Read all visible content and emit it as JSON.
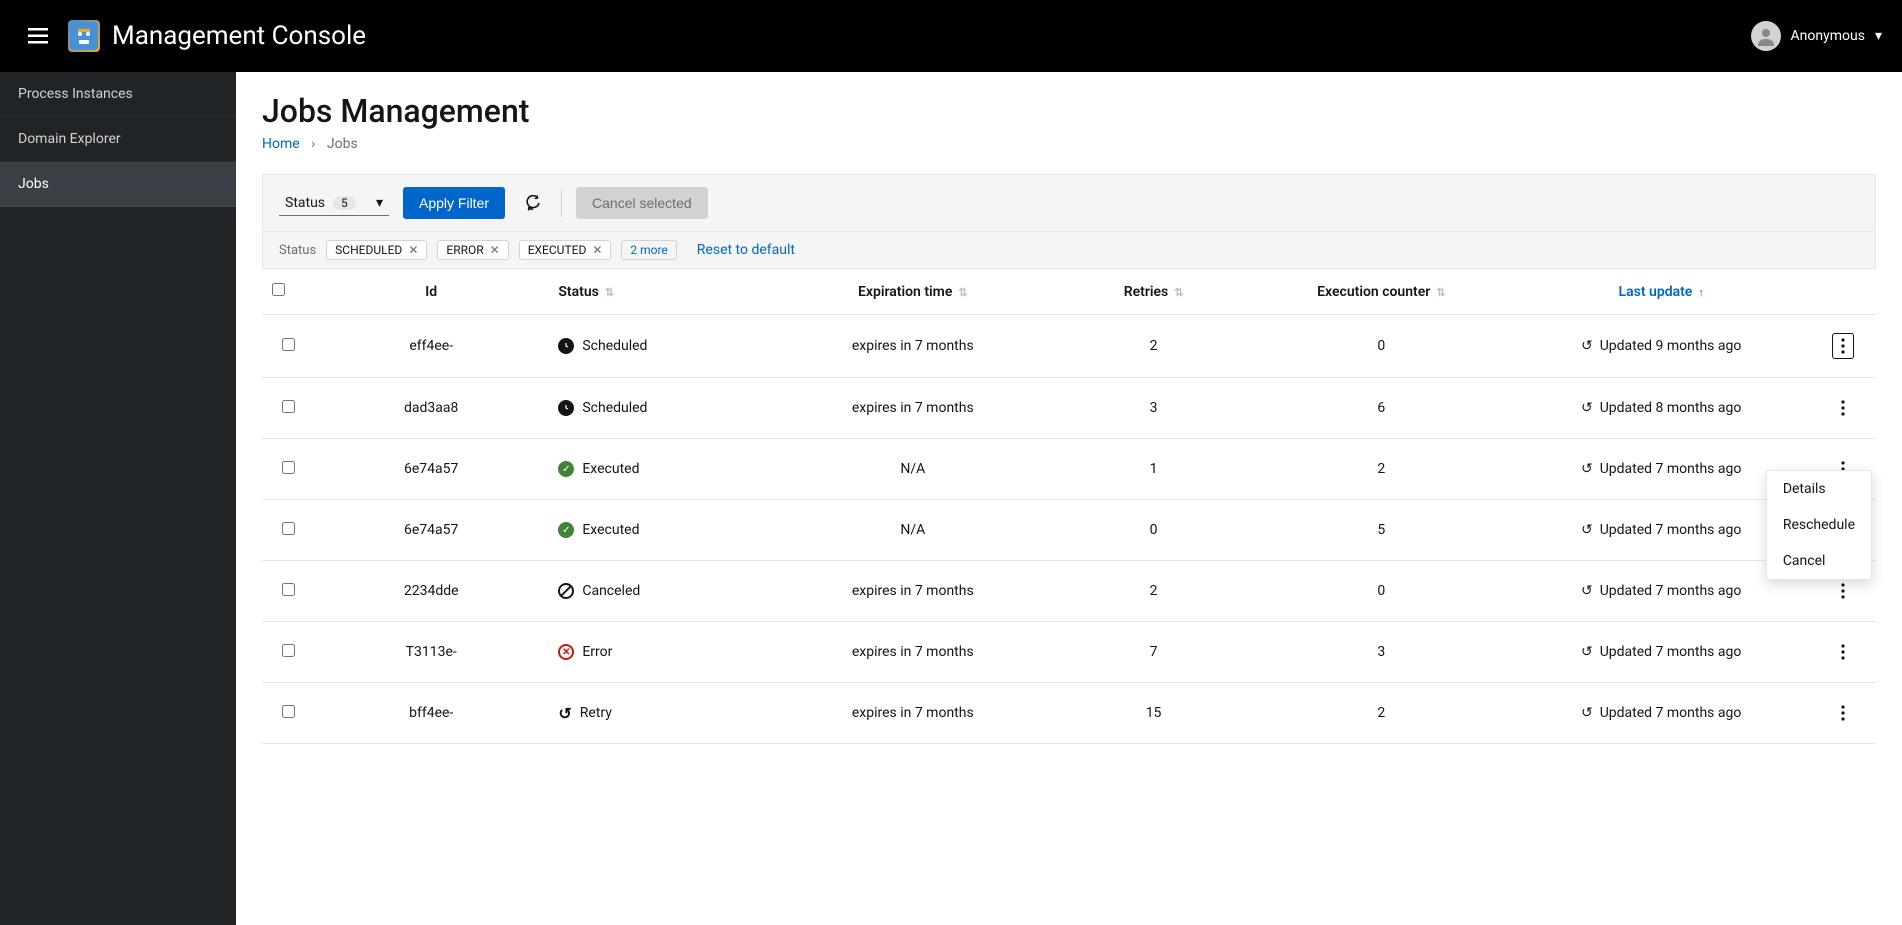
{
  "header": {
    "title": "Management Console",
    "user_label": "Anonymous"
  },
  "sidebar": {
    "items": [
      {
        "label": "Process Instances"
      },
      {
        "label": "Domain Explorer"
      },
      {
        "label": "Jobs"
      }
    ]
  },
  "page": {
    "title": "Jobs Management",
    "breadcrumb_home": "Home",
    "breadcrumb_current": "Jobs"
  },
  "toolbar": {
    "status_label": "Status",
    "status_count": "5",
    "apply_filter": "Apply Filter",
    "cancel_selected": "Cancel selected"
  },
  "filters": {
    "label": "Status",
    "chips": [
      "SCHEDULED",
      "ERROR",
      "EXECUTED"
    ],
    "more": "2 more",
    "reset": "Reset to default"
  },
  "columns": {
    "id": "Id",
    "status": "Status",
    "expiration": "Expiration time",
    "retries": "Retries",
    "execution": "Execution counter",
    "last_update": "Last update"
  },
  "rows": [
    {
      "id": "eff4ee-",
      "status": "Scheduled",
      "status_type": "clock",
      "expiration": "expires in 7 months",
      "retries": "2",
      "execution": "0",
      "last_update": "Updated 9 months ago",
      "menu_open": true
    },
    {
      "id": "dad3aa8",
      "status": "Scheduled",
      "status_type": "clock",
      "expiration": "expires in 7 months",
      "retries": "3",
      "execution": "6",
      "last_update": "Updated 8 months ago"
    },
    {
      "id": "6e74a57",
      "status": "Executed",
      "status_type": "check",
      "expiration": "N/A",
      "retries": "1",
      "execution": "2",
      "last_update": "Updated 7 months ago"
    },
    {
      "id": "6e74a57",
      "status": "Executed",
      "status_type": "check",
      "expiration": "N/A",
      "retries": "0",
      "execution": "5",
      "last_update": "Updated 7 months ago"
    },
    {
      "id": "2234dde",
      "status": "Canceled",
      "status_type": "ban",
      "expiration": "expires in 7 months",
      "retries": "2",
      "execution": "0",
      "last_update": "Updated 7 months ago"
    },
    {
      "id": "T3113e-",
      "status": "Error",
      "status_type": "error",
      "expiration": "expires in 7 months",
      "retries": "7",
      "execution": "3",
      "last_update": "Updated 7 months ago"
    },
    {
      "id": "bff4ee-",
      "status": "Retry",
      "status_type": "retry",
      "expiration": "expires in 7 months",
      "retries": "15",
      "execution": "2",
      "last_update": "Updated 7 months ago"
    }
  ],
  "row_menu": {
    "details": "Details",
    "reschedule": "Reschedule",
    "cancel": "Cancel"
  }
}
